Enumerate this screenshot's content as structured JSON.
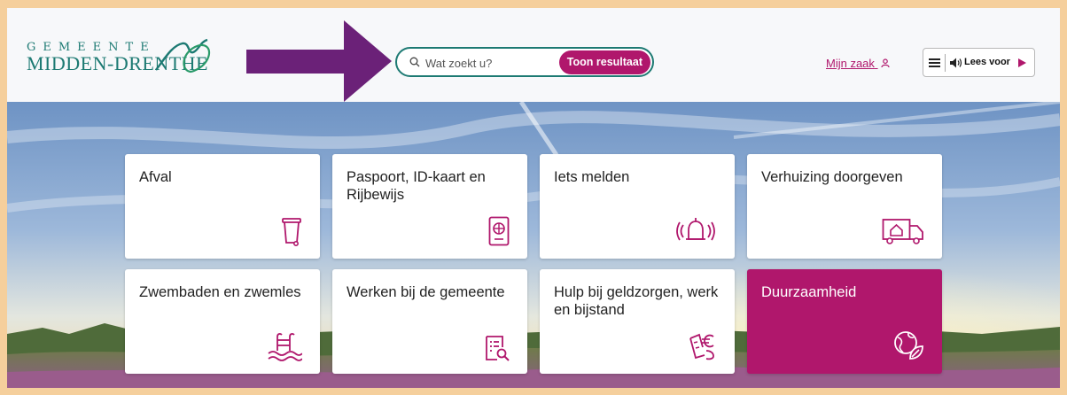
{
  "header": {
    "logo_top": "GEMEENTE",
    "logo_bottom": "MIDDEN-DRENTHE",
    "search": {
      "placeholder": "Wat zoekt u?",
      "button_label": "Toon resultaat"
    },
    "account_link": "Mijn zaak",
    "read_aloud_label": "Lees voor"
  },
  "tiles": [
    {
      "label": "Afval",
      "icon": "trash-bin-icon"
    },
    {
      "label": "Paspoort, ID-kaart en Rijbewijs",
      "icon": "passport-icon"
    },
    {
      "label": "Iets melden",
      "icon": "bell-alert-icon"
    },
    {
      "label": "Verhuizing doorgeven",
      "icon": "moving-truck-icon"
    },
    {
      "label": "Zwembaden en zwemles",
      "icon": "swimming-pool-icon"
    },
    {
      "label": "Werken bij de gemeente",
      "icon": "job-application-icon"
    },
    {
      "label": "Hulp bij geldzorgen, werk en bijstand",
      "icon": "euro-receipt-icon"
    },
    {
      "label": "Duurzaamheid",
      "icon": "globe-leaf-icon",
      "active": true
    }
  ],
  "colors": {
    "brand_magenta": "#b0176c",
    "brand_teal": "#1d7a73",
    "frame_border": "#f5cf9c",
    "annotation_arrow": "#6b2178"
  }
}
